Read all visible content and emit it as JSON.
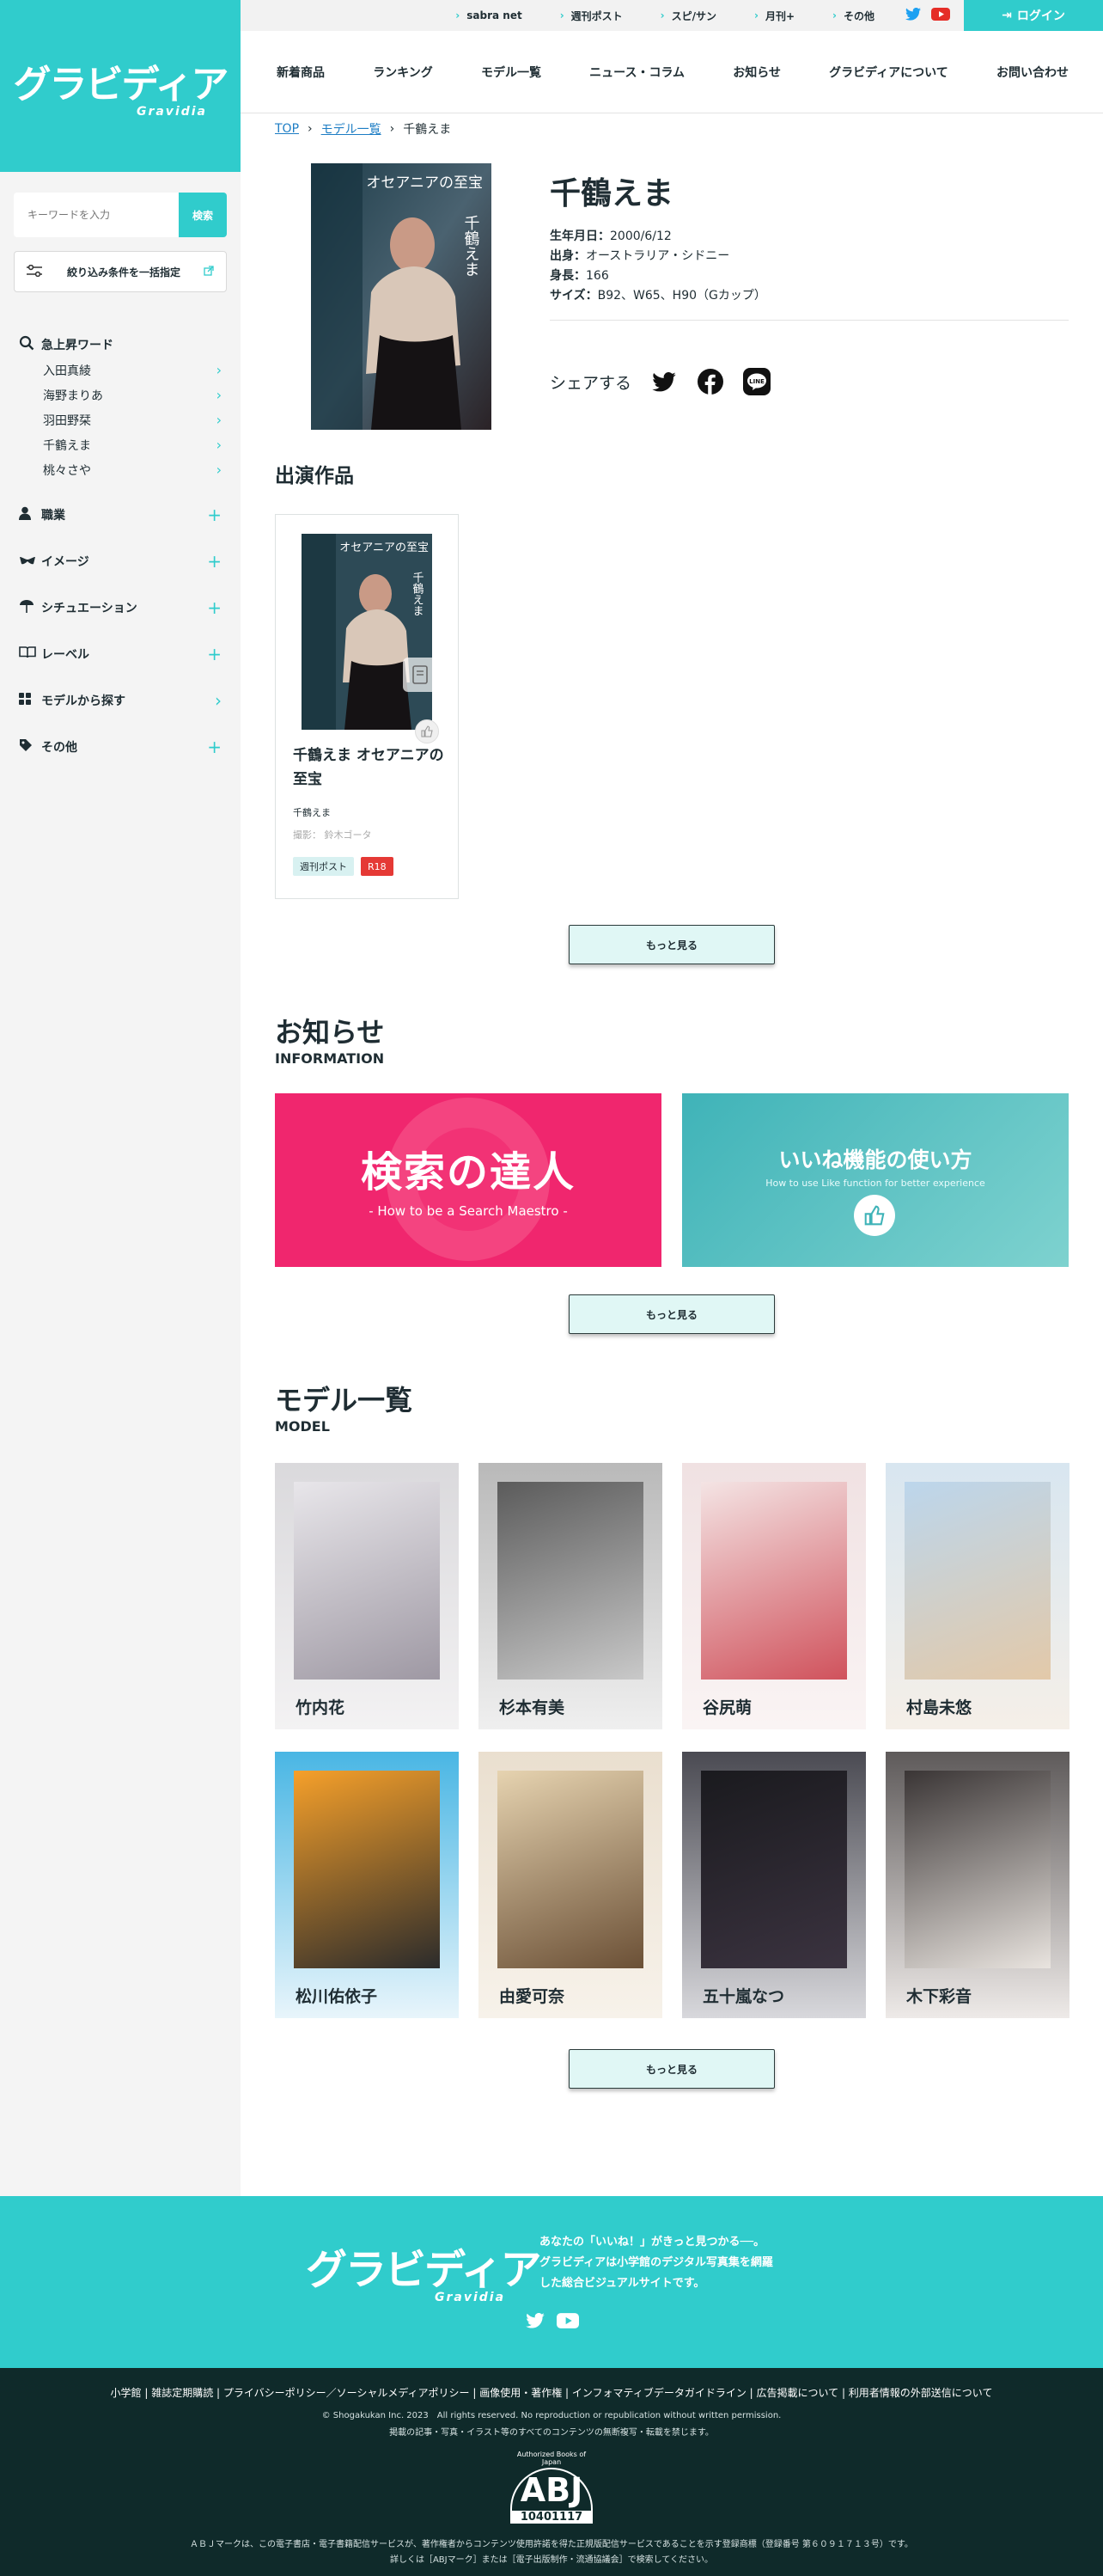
{
  "brand": {
    "logo_text": "グラビディア",
    "logo_sub": "Gravidia"
  },
  "topbar": {
    "links": [
      "sabra net",
      "週刊ポスト",
      "スピ/サン",
      "月刊+",
      "その他"
    ],
    "login": "ログイン"
  },
  "nav": [
    "新着商品",
    "ランキング",
    "モデル一覧",
    "ニュース・コラム",
    "お知らせ",
    "グラビディアについて",
    "お問い合わせ"
  ],
  "sidebar": {
    "search_placeholder": "キーワードを入力",
    "search_button": "検索",
    "filter_label": "絞り込み条件を一括指定",
    "trend_title": "急上昇ワード",
    "trend_items": [
      "入田真綾",
      "海野まりあ",
      "羽田野栞",
      "千鶴えま",
      "桃々さや"
    ],
    "categories": [
      "職業",
      "イメージ",
      "シチュエーション",
      "レーベル",
      "モデルから探す",
      "その他"
    ]
  },
  "breadcrumb": {
    "top": "TOP",
    "models": "モデル一覧",
    "current": "千鶴えま"
  },
  "model": {
    "name": "千鶴えま",
    "birth_label": "生年月日：",
    "birth": "2000/6/12",
    "origin_label": "出身：",
    "origin": "オーストラリア・シドニー",
    "height_label": "身長：",
    "height": "166",
    "size_label": "サイズ：",
    "size": "B92、W65、H90（Gカップ）",
    "share": "シェアする",
    "cover_title": "オセアニアの至宝",
    "cover_name": "千鶴えま"
  },
  "works": {
    "heading": "出演作品",
    "title": "千鶴えま オセアニアの至宝",
    "model": "千鶴えま",
    "photographer": "撮影： 鈴木ゴータ",
    "tags": [
      "週刊ポスト",
      "R18"
    ],
    "more": "もっと見る"
  },
  "news": {
    "heading": "お知らせ",
    "heading_en": "INFORMATION",
    "banner1_title": "検索の達人",
    "banner1_sub": "- How to be a Search Maestro -",
    "banner2_title": "いいね機能の使い方",
    "banner2_sub": "How to use Like function for better experience",
    "more": "もっと見る"
  },
  "models_list": {
    "heading": "モデル一覧",
    "heading_en": "MODEL",
    "items": [
      "竹内花",
      "杉本有美",
      "谷尻萌",
      "村島未悠",
      "松川佑依子",
      "由愛可奈",
      "五十嵐なつ",
      "木下彩音"
    ],
    "more": "もっと見る"
  },
  "footer": {
    "tagline": [
      "あなたの「いいね！」がきっと見つかる──。",
      "グラビディアは小学館のデジタル写真集を網羅",
      "した総合ビジュアルサイトです。"
    ],
    "links": "小学館 | 雑誌定期購読 | プライバシーポリシー／ソーシャルメディアポリシー | 画像使用・著作権 | インフォマティブデータガイドライン | 広告掲載について | 利用者情報の外部送信について",
    "copyright": "© Shogakukan Inc. 2023　All rights reserved. No reproduction or republication without written permission.",
    "notice": "掲載の記事・写真・イラスト等のすべてのコンテンツの無断複写・転載を禁じます。",
    "abj_small": "Authorized Books of Japan",
    "abj": "ABJ",
    "abj_no": "10401117",
    "abj_note1": "ＡＢＪマークは、この電子書店・電子書籍配信サービスが、著作権者からコンテンツ使用許諾を得た正規版配信サービスであることを示す登録商標（登録番号 第６０９１７１３号）です。",
    "abj_note2": "詳しくは［ABJマーク］または［電子出版制作・流通協議会］で検索してください。"
  },
  "colors": {
    "accent": "#30cccc",
    "footer_dark": "#0f2a2a",
    "r18": "#e53935"
  }
}
